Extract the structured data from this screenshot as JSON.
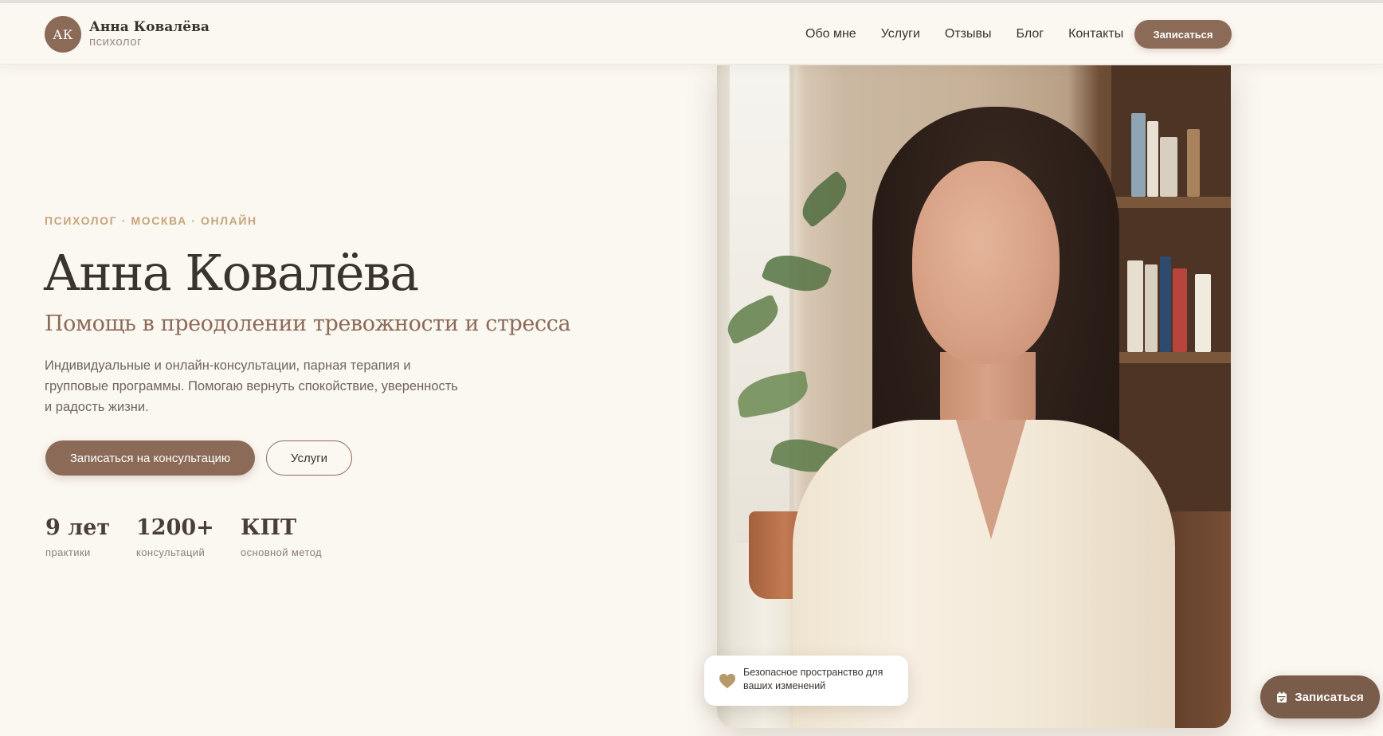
{
  "header": {
    "avatar_initials": "АК",
    "brand_name": "Анна Ковалёва",
    "brand_role": "психолог",
    "nav": [
      "Обо мне",
      "Услуги",
      "Отзывы",
      "Блог",
      "Контакты"
    ],
    "cta_label": "Записаться"
  },
  "hero": {
    "eyebrow": "ПСИХОЛОГ · МОСКВА · ОНЛАЙН",
    "title": "Анна Ковалёва",
    "subtitle": "Помощь в преодолении тревожности и стресса",
    "description": "Индивидуальные и онлайн-консультации, парная терапия и групповые программы. Помогаю вернуть спокойствие, уверенность и радость жизни.",
    "primary_button": "Записаться на консультацию",
    "secondary_button": "Услуги",
    "stats": [
      {
        "value": "9 лет",
        "label": "практики"
      },
      {
        "value": "1200+",
        "label": "консультаций"
      },
      {
        "value": "КПТ",
        "label": "основной метод"
      }
    ]
  },
  "badge": {
    "icon": "heart-icon",
    "text": "Безопасное пространство для ваших изменений"
  },
  "fab": {
    "icon": "calendar-icon",
    "label": "Записаться"
  },
  "colors": {
    "accent": "#8b6a57",
    "background": "#fbf7f1",
    "eyebrow": "#c5a57a",
    "text": "#3b342e",
    "heart": "#b69a6a"
  }
}
